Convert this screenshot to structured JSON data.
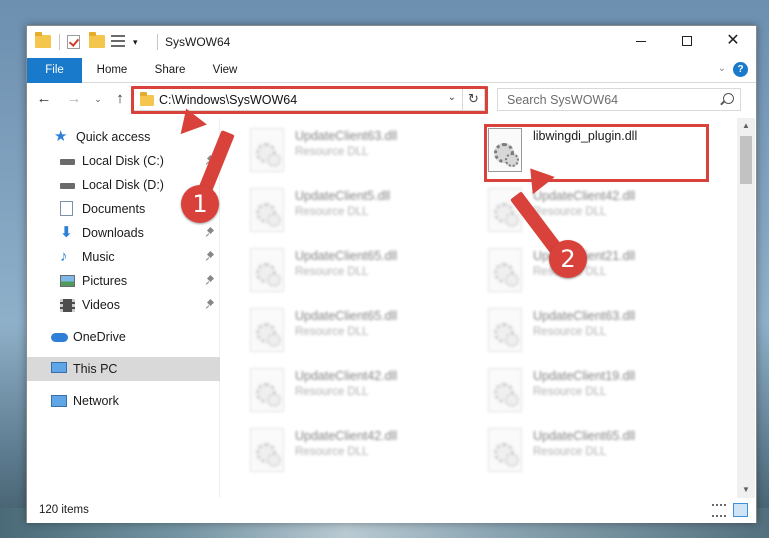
{
  "window": {
    "title": "SysWOW64",
    "minimize_glyph": "—",
    "maximize_glyph": "☐",
    "close_glyph": "✕"
  },
  "ribbon": {
    "tabs": [
      "File",
      "Home",
      "Share",
      "View"
    ],
    "expand_glyph": "⌄",
    "help_glyph": "?"
  },
  "nav": {
    "back_glyph": "←",
    "forward_glyph": "→",
    "recent_glyph": "⌄",
    "up_glyph": "↑",
    "address_path": "C:\\Windows\\SysWOW64",
    "address_dropdown_glyph": "⌄",
    "refresh_glyph": "↻",
    "search_placeholder": "Search SysWOW64"
  },
  "sidebar": {
    "items": [
      {
        "label": "Quick access",
        "icon": "star-icon"
      },
      {
        "label": "Local Disk (C:)",
        "icon": "disk-icon"
      },
      {
        "label": "Local Disk (D:)",
        "icon": "disk-icon"
      },
      {
        "label": "Documents",
        "icon": "documents-icon"
      },
      {
        "label": "Downloads",
        "icon": "downloads-icon"
      },
      {
        "label": "Music",
        "icon": "music-icon"
      },
      {
        "label": "Pictures",
        "icon": "pictures-icon"
      },
      {
        "label": "Videos",
        "icon": "videos-icon"
      },
      {
        "label": "OneDrive",
        "icon": "cloud-icon"
      },
      {
        "label": "This PC",
        "icon": "computer-icon"
      },
      {
        "label": "Network",
        "icon": "network-icon"
      }
    ]
  },
  "files": {
    "left_column": [
      {
        "name": "UpdateClient63.dll",
        "type": "Resource DLL"
      },
      {
        "name": "UpdateClient5.dll",
        "type": "Resource DLL"
      },
      {
        "name": "UpdateClient65.dll",
        "type": "Resource DLL"
      },
      {
        "name": "UpdateClient65.dll",
        "type": "Resource DLL"
      },
      {
        "name": "UpdateClient42.dll",
        "type": "Resource DLL"
      },
      {
        "name": "UpdateClient42.dll",
        "type": "Resource DLL"
      }
    ],
    "right_column": [
      {
        "name": "libwingdi_plugin.dll",
        "type": ""
      },
      {
        "name": "UpdateClient42.dll",
        "type": "Resource DLL"
      },
      {
        "name": "UpdateClient21.dll",
        "type": "Resource DLL"
      },
      {
        "name": "UpdateClient63.dll",
        "type": "Resource DLL"
      },
      {
        "name": "UpdateClient19.dll",
        "type": "Resource DLL"
      },
      {
        "name": "UpdateClient65.dll",
        "type": "Resource DLL"
      }
    ]
  },
  "scrollbar": {
    "up_glyph": "▲",
    "down_glyph": "▼"
  },
  "status": {
    "item_count": "120 items"
  },
  "annotations": {
    "step1": "1",
    "step2": "2"
  },
  "colors": {
    "accent": "#1979ca",
    "annotation": "#d9423a"
  }
}
